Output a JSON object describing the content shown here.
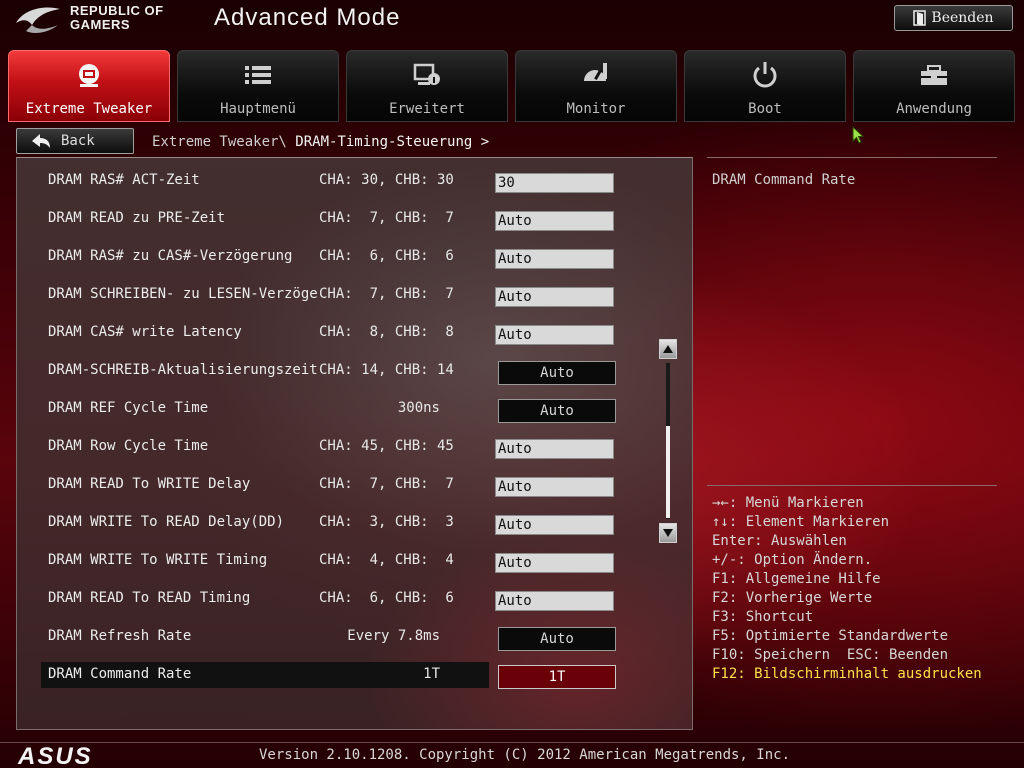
{
  "header": {
    "brand_line1": "REPUBLIC OF",
    "brand_line2": "GAMERS",
    "mode_title": "Advanced Mode",
    "exit_label": "Beenden"
  },
  "tabs": [
    {
      "label": "Extreme Tweaker",
      "icon": "tweaker-icon",
      "active": true
    },
    {
      "label": "Hauptmenü",
      "icon": "list-icon",
      "active": false
    },
    {
      "label": "Erweitert",
      "icon": "advanced-icon",
      "active": false
    },
    {
      "label": "Monitor",
      "icon": "monitor-gauge-icon",
      "active": false
    },
    {
      "label": "Boot",
      "icon": "power-icon",
      "active": false
    },
    {
      "label": "Anwendung",
      "icon": "tools-icon",
      "active": false
    }
  ],
  "nav": {
    "back_label": "Back",
    "breadcrumb_parent": "Extreme Tweaker\\",
    "breadcrumb_current": "DRAM-Timing-Steuerung >"
  },
  "settings": [
    {
      "label": "DRAM RAS# ACT-Zeit",
      "current": "CHA: 30, CHB: 30",
      "value": "30",
      "control": "input"
    },
    {
      "label": "DRAM READ zu PRE-Zeit",
      "current": "CHA:  7, CHB:  7",
      "value": "Auto",
      "control": "input"
    },
    {
      "label": "DRAM RAS# zu CAS#-Verzögerung",
      "current": "CHA:  6, CHB:  6",
      "value": "Auto",
      "control": "input"
    },
    {
      "label": "DRAM SCHREIBEN- zu LESEN-Verzöge",
      "current": "CHA:  7, CHB:  7",
      "value": "Auto",
      "control": "input"
    },
    {
      "label": "DRAM CAS# write Latency",
      "current": "CHA:  8, CHB:  8",
      "value": "Auto",
      "control": "input"
    },
    {
      "label": "DRAM-SCHREIB-Aktualisierungszeit",
      "current": "CHA: 14, CHB: 14",
      "value": "Auto",
      "control": "select"
    },
    {
      "label": "DRAM REF Cycle Time",
      "current": "300ns",
      "value": "Auto",
      "control": "select",
      "align": "right"
    },
    {
      "label": "DRAM Row Cycle Time",
      "current": "CHA: 45, CHB: 45",
      "value": "Auto",
      "control": "input"
    },
    {
      "label": "DRAM READ To WRITE Delay",
      "current": "CHA:  7, CHB:  7",
      "value": "Auto",
      "control": "input"
    },
    {
      "label": "DRAM WRITE To READ Delay(DD)",
      "current": "CHA:  3, CHB:  3",
      "value": "Auto",
      "control": "input"
    },
    {
      "label": "DRAM WRITE To WRITE Timing",
      "current": "CHA:  4, CHB:  4",
      "value": "Auto",
      "control": "input"
    },
    {
      "label": "DRAM READ To READ Timing",
      "current": "CHA:  6, CHB:  6",
      "value": "Auto",
      "control": "input"
    },
    {
      "label": "DRAM Refresh Rate",
      "current": "Every 7.8ms",
      "value": "Auto",
      "control": "select",
      "align": "right"
    },
    {
      "label": "DRAM Command Rate",
      "current": "1T",
      "value": "1T",
      "control": "select",
      "align": "right",
      "selected": true
    }
  ],
  "help": {
    "title": "DRAM Command Rate",
    "keys": [
      "→←: Menü Markieren",
      "↑↓: Element Markieren",
      "Enter: Auswählen",
      "+/-: Option Ändern.",
      "F1: Allgemeine Hilfe",
      "F2: Vorherige Werte",
      "F3: Shortcut",
      "F5: Optimierte Standardwerte",
      "F10: Speichern  ESC: Beenden",
      "F12: Bildschirminhalt ausdrucken"
    ]
  },
  "footer": {
    "logo": "ASUS",
    "version": "Version 2.10.1208. Copyright (C) 2012 American Megatrends, Inc."
  },
  "colors": {
    "accent": "#c01015",
    "selected_value_bg": "#6a0008",
    "highlight_key": "#ffe14a"
  }
}
